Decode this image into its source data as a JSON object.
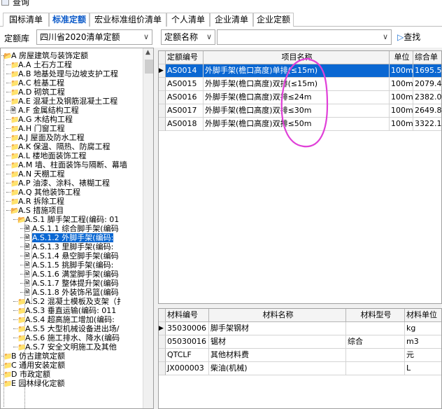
{
  "window": {
    "title": "查询"
  },
  "tabs": [
    "国标清单",
    "标准定额",
    "宏业标准组价清单",
    "个人清单",
    "企业清单",
    "企业定额"
  ],
  "toolbar": {
    "library_label": "定额库",
    "library_value": "四川省2020清单定额",
    "field_select": "定额名称",
    "search_value": "",
    "find_label": "查找"
  },
  "tree": [
    {
      "label": "A 房屋建筑与装饰定额",
      "level": 0,
      "icon": "folder-open"
    },
    {
      "label": "A.A 土石方工程",
      "level": 1,
      "icon": "folder"
    },
    {
      "label": "A.B 地基处理与边坡支护工程",
      "level": 1,
      "icon": "folder"
    },
    {
      "label": "A.C 桩基工程",
      "level": 1,
      "icon": "folder"
    },
    {
      "label": "A.D 砌筑工程",
      "level": 1,
      "icon": "folder"
    },
    {
      "label": "A.E 混凝土及钢筋混凝土工程",
      "level": 1,
      "icon": "folder"
    },
    {
      "label": "A.F 金属结构工程",
      "level": 1,
      "icon": "doc"
    },
    {
      "label": "A.G 木结构工程",
      "level": 1,
      "icon": "folder"
    },
    {
      "label": "A.H 门窗工程",
      "level": 1,
      "icon": "folder"
    },
    {
      "label": "A.J 屋面及防水工程",
      "level": 1,
      "icon": "folder"
    },
    {
      "label": "A.K 保温、隔热、防腐工程",
      "level": 1,
      "icon": "folder"
    },
    {
      "label": "A.L 楼地面装饰工程",
      "level": 1,
      "icon": "folder"
    },
    {
      "label": "A.M 墙、柱面装饰与隔断、幕墙",
      "level": 1,
      "icon": "folder"
    },
    {
      "label": "A.N 天棚工程",
      "level": 1,
      "icon": "folder"
    },
    {
      "label": "A.P 油漆、涂料、裱糊工程",
      "level": 1,
      "icon": "folder"
    },
    {
      "label": "A.Q 其他装饰工程",
      "level": 1,
      "icon": "folder"
    },
    {
      "label": "A.R 拆除工程",
      "level": 1,
      "icon": "folder"
    },
    {
      "label": "A.S 措施项目",
      "level": 1,
      "icon": "folder-open"
    },
    {
      "label": "A.S.1 脚手架工程(编码: 01",
      "level": 2,
      "icon": "folder-open"
    },
    {
      "label": "A.S.1.1 综合脚手架(编码",
      "level": 3,
      "icon": "doc"
    },
    {
      "label": "A.S.1.2 外脚手架(编码:",
      "level": 3,
      "icon": "doc",
      "selected": true
    },
    {
      "label": "A.S.1.3 里脚手架(编码:",
      "level": 3,
      "icon": "doc"
    },
    {
      "label": "A.S.1.4 悬空脚手架(编码",
      "level": 3,
      "icon": "doc"
    },
    {
      "label": "A.S.1.5 挑脚手架(编码:",
      "level": 3,
      "icon": "doc"
    },
    {
      "label": "A.S.1.6 满堂脚手架(编码",
      "level": 3,
      "icon": "doc"
    },
    {
      "label": "A.S.1.7 整体提升架(编码",
      "level": 3,
      "icon": "doc"
    },
    {
      "label": "A.S.1.8 外装饰吊篮(编码",
      "level": 3,
      "icon": "doc"
    },
    {
      "label": "A.S.2 混凝土模板及支架（扌",
      "level": 2,
      "icon": "folder"
    },
    {
      "label": "A.S.3 垂直运输(编码: 011",
      "level": 2,
      "icon": "folder"
    },
    {
      "label": "A.S.4 超高施工增加(编码:",
      "level": 2,
      "icon": "folder"
    },
    {
      "label": "A.S.5 大型机械设备进出场/",
      "level": 2,
      "icon": "folder"
    },
    {
      "label": "A.S.6 施工排水、降水(编码",
      "level": 2,
      "icon": "folder"
    },
    {
      "label": "A.S.7 安全文明施工及其他",
      "level": 2,
      "icon": "folder"
    },
    {
      "label": "B 仿古建筑定额",
      "level": 0,
      "icon": "folder"
    },
    {
      "label": "C 通用安装定额",
      "level": 0,
      "icon": "folder"
    },
    {
      "label": "D 市政定额",
      "level": 0,
      "icon": "folder"
    },
    {
      "label": "E 园林绿化定额",
      "level": 0,
      "icon": "folder"
    }
  ],
  "quota_grid": {
    "columns": [
      "定额编号",
      "项目名称",
      "单位",
      "综合单"
    ],
    "rows": [
      {
        "code": "AS0014",
        "name": "外脚手架(檐口高度)单排(≤15m)",
        "unit": "100m2",
        "price": "1695.5",
        "selected": true
      },
      {
        "code": "AS0015",
        "name": "外脚手架(檐口高度)双排(≤15m)",
        "unit": "100m2",
        "price": "2079.4"
      },
      {
        "code": "AS0016",
        "name": "外脚手架(檐口高度)双排≤24m",
        "unit": "100m2",
        "price": "2382.0"
      },
      {
        "code": "AS0017",
        "name": "外脚手架(檐口高度)双排≤30m",
        "unit": "100m2",
        "price": "2649.8"
      },
      {
        "code": "AS0018",
        "name": "外脚手架(檐口高度)双排≤50m",
        "unit": "100m2",
        "price": "3322.1"
      }
    ]
  },
  "material_grid": {
    "columns": [
      "材料编号",
      "材料名称",
      "材料型号",
      "材料单位"
    ],
    "rows": [
      {
        "code": "35030006",
        "name": "脚手架钢材",
        "model": "",
        "unit": "kg"
      },
      {
        "code": "05030016",
        "name": "锯材",
        "model": "综合",
        "unit": "m3"
      },
      {
        "code": "QTCLF",
        "name": "其他材料费",
        "model": "",
        "unit": "元"
      },
      {
        "code": "JX000003",
        "name": "柴油(机械)",
        "model": "",
        "unit": "L"
      }
    ]
  },
  "colors": {
    "selection": "#0a67d2",
    "active_tab": "#0a59c8",
    "annotation": "#e040d8"
  }
}
